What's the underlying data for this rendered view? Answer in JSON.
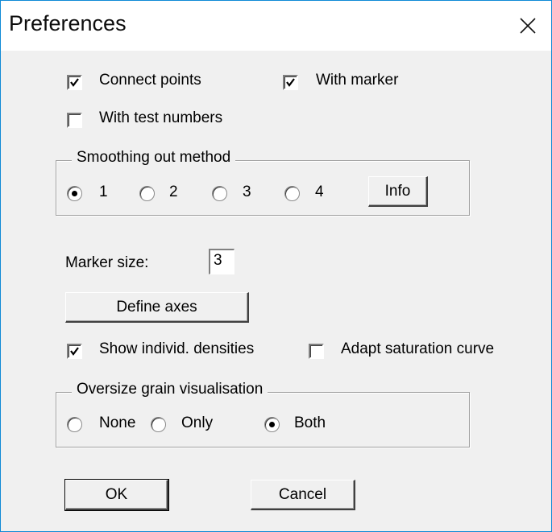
{
  "window": {
    "title": "Preferences"
  },
  "options": {
    "connect_points": {
      "label": "Connect points",
      "checked": true
    },
    "with_marker": {
      "label": "With marker",
      "checked": true
    },
    "with_test_numbers": {
      "label": "With test numbers",
      "checked": false
    }
  },
  "smoothing": {
    "group_title": "Smoothing out method",
    "options": [
      "1",
      "2",
      "3",
      "4"
    ],
    "selected": "1",
    "info_label": "Info"
  },
  "marker": {
    "label": "Marker size:",
    "value": "3"
  },
  "define_axes_label": "Define axes",
  "densities": {
    "show_individ": {
      "label": "Show individ. densities",
      "checked": true
    },
    "adapt_saturation": {
      "label": "Adapt saturation curve",
      "checked": false
    }
  },
  "oversize": {
    "group_title": "Oversize grain visualisation",
    "options": [
      "None",
      "Only",
      "Both"
    ],
    "selected": "Both"
  },
  "buttons": {
    "ok": "OK",
    "cancel": "Cancel"
  },
  "colors": {
    "window_border": "#0f8ad6",
    "dialog_bg": "#f0f0f0",
    "titlebar_bg": "#ffffff"
  },
  "icons": {
    "close": "close-icon",
    "check": "checkmark-icon"
  }
}
